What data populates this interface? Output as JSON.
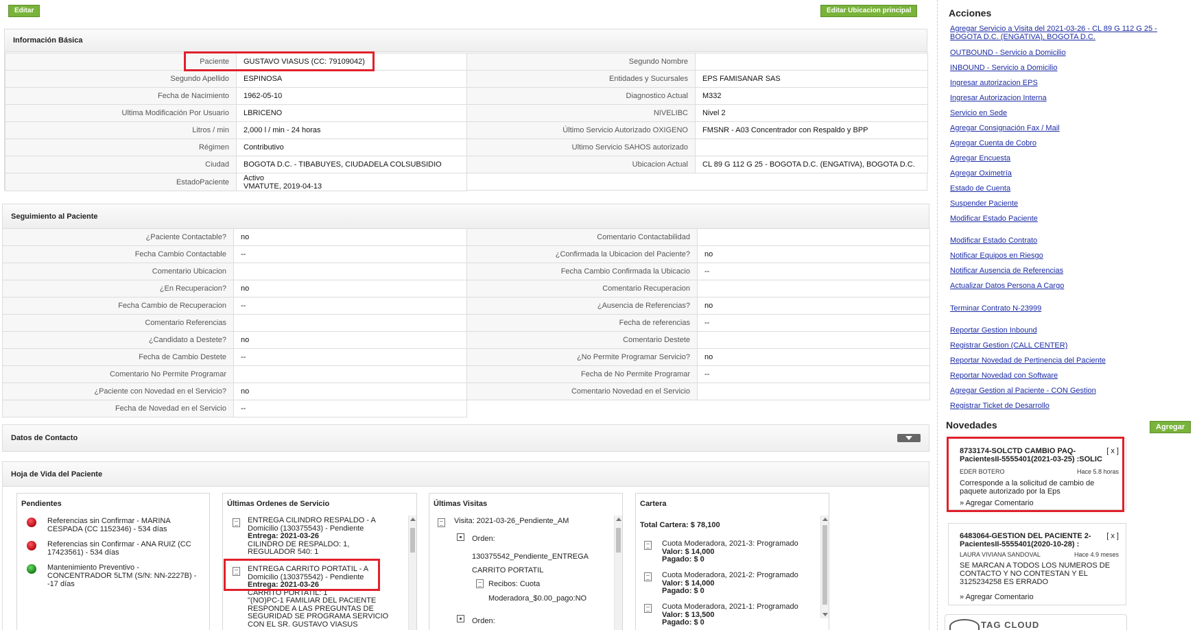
{
  "toolbar": {
    "edit_label": "Editar",
    "edit_location_label": "Editar Ubicacion principal"
  },
  "info_basica": {
    "title": "Información Básica",
    "left": [
      {
        "label": "Paciente",
        "value": "GUSTAVO VIASUS (CC: 79109042)"
      },
      {
        "label": "Segundo Apellido",
        "value": "ESPINOSA"
      },
      {
        "label": "Fecha de Nacimiento",
        "value": "1962-05-10"
      },
      {
        "label": "Ultima Modificación Por Usuario",
        "value": "LBRICENO"
      },
      {
        "label": "Litros / min",
        "value": "2,000 l / min - 24 horas"
      },
      {
        "label": "Régimen",
        "value": "Contributivo"
      },
      {
        "label": "Ciudad",
        "value": "BOGOTA D.C. - TIBABUYES, CIUDADELA COLSUBSIDIO"
      },
      {
        "label": "EstadoPaciente",
        "value1": "Activo",
        "value2": "VMATUTE, 2019-04-13"
      }
    ],
    "right": [
      {
        "label": "Segundo Nombre",
        "value": ""
      },
      {
        "label": "Entidades y Sucursales",
        "value": "EPS FAMISANAR SAS"
      },
      {
        "label": "Diagnostico Actual",
        "value": "M332"
      },
      {
        "label": "NIVELIBC",
        "value": "Nivel 2"
      },
      {
        "label": "Último Servicio Autorizado OXIGENO",
        "value": "FMSNR - A03 Concentrador con Respaldo y BPP"
      },
      {
        "label": "Ultimo Servicio SAHOS autorizado",
        "value": ""
      },
      {
        "label": "Ubicacion Actual",
        "value": "CL 89 G 112 G 25 - BOGOTA D.C. (ENGATIVA), BOGOTA D.C."
      }
    ]
  },
  "seguimiento": {
    "title": "Seguimiento al Paciente",
    "left": [
      {
        "label": "¿Paciente Contactable?",
        "value": "no"
      },
      {
        "label": "Fecha Cambio Contactable",
        "value": "--"
      },
      {
        "label": "Comentario Ubicacion",
        "value": ""
      },
      {
        "label": "¿En Recuperacion?",
        "value": "no"
      },
      {
        "label": "Fecha Cambio de Recuperacion",
        "value": "--"
      },
      {
        "label": "Comentario Referencias",
        "value": ""
      },
      {
        "label": "¿Candidato a Destete?",
        "value": "no"
      },
      {
        "label": "Fecha de Cambio Destete",
        "value": "--"
      },
      {
        "label": "Comentario No Permite Programar",
        "value": ""
      },
      {
        "label": "¿Paciente con Novedad en el Servicio?",
        "value": "no"
      },
      {
        "label": "Fecha de Novedad en el Servicio",
        "value": "--"
      }
    ],
    "right": [
      {
        "label": "Comentario Contactabilidad",
        "value": ""
      },
      {
        "label": "¿Confirmada la Ubicacion del Paciente?",
        "value": "no"
      },
      {
        "label": "Fecha Cambio Confirmada la Ubicacio",
        "value": "--"
      },
      {
        "label": "Comentario Recuperacion",
        "value": ""
      },
      {
        "label": "¿Ausencia de Referencias?",
        "value": "no"
      },
      {
        "label": "Fecha de referencias",
        "value": "--"
      },
      {
        "label": "Comentario Destete",
        "value": ""
      },
      {
        "label": "¿No Permite Programar Servicio?",
        "value": "no"
      },
      {
        "label": "Fecha de No Permite Programar",
        "value": "--"
      },
      {
        "label": "Comentario Novedad en el Servicio",
        "value": ""
      }
    ]
  },
  "contacto": {
    "title": "Datos de Contacto"
  },
  "hoja": {
    "title": "Hoja de Vida del Paciente",
    "pendientes": {
      "title": "Pendientes",
      "items": [
        {
          "text": "Referencias sin Confirmar - MARINA CESPADA (CC 1152346) - 534 días",
          "status": "red"
        },
        {
          "text": "Referencias sin Confirmar - ANA RUIZ (CC 17423561) - 534 días",
          "status": "red"
        },
        {
          "text": "Mantenimiento Preventivo - CONCENTRADOR 5LTM (S/N: NN-2227B) - -17 días",
          "status": "green"
        }
      ]
    },
    "ordenes": {
      "title": "Últimas Ordenes de Servicio",
      "o1_title": "ENTREGA CILINDRO RESPALDO - A Domicilio (130375543) - Pendiente",
      "o1_date": "Entrega: 2021-03-26",
      "o1_desc": "CILINDRO DE RESPALDO: 1, REGULADOR 540: 1",
      "o2_title": "ENTREGA CARRITO PORTATIL - A Domicilio (130375542) - Pendiente",
      "o2_date": "Entrega: 2021-03-26",
      "o2_desc1": "CARRITO PORTATIL: 1",
      "o2_desc2": "\"(NO)PC-1 FAMILIAR DEL PACIENTE RESPONDE A LAS PREGUNTAS DE SEGURIDAD SE PROGRAMA SERVICIO CON EL SR. GUSTAVO VIASUS"
    },
    "visitas": {
      "title": "Últimas Visitas",
      "visit": "Visita: 2021-03-26_Pendiente_AM",
      "orden_label": "Orden:",
      "orden_value1": "130375542_Pendiente_ENTREGA",
      "orden_value2": "CARRITO PORTATIL",
      "recibos1": "Recibos: Cuota",
      "recibos2": "Moderadora_$0.00_pago:NO",
      "orden2_label": "Orden:"
    },
    "cartera": {
      "title": "Cartera",
      "total": "Total Cartera: $ 78,100",
      "items": [
        {
          "title": "Cuota Moderadora, 2021-3: Programado",
          "valor": "Valor: $ 14,000",
          "pagado": "Pagado: $ 0"
        },
        {
          "title": "Cuota Moderadora, 2021-2: Programado",
          "valor": "Valor: $ 14,000",
          "pagado": "Pagado: $ 0"
        },
        {
          "title": "Cuota Moderadora, 2021-1: Programado",
          "valor": "Valor: $ 13,500",
          "pagado": "Pagado: $ 0"
        }
      ]
    }
  },
  "acciones": {
    "title": "Acciones",
    "items": [
      "Agregar Servicio a Visita del 2021-03-26 - CL 89 G 112 G 25 -",
      "BOGOTA D.C. (ENGATIVA), BOGOTA D.C.",
      "OUTBOUND - Servicio a Domicilio",
      "INBOUND - Servicio a Domicilio",
      "Ingresar autorizacion EPS",
      "Ingresar Autorizacion Interna",
      "Servicio en Sede",
      "Agregar Consignación Fax / Mail",
      "Agregar Cuenta de Cobro",
      "Agregar Encuesta",
      "Agregar Oximetría",
      "Estado de Cuenta",
      "Suspender Paciente",
      "Modificar Estado Paciente",
      "Modificar Estado Contrato",
      "Notificar Equipos en Riesgo",
      "Notificar Ausencia de Referencias",
      "Actualizar Datos Persona A Cargo",
      "Terminar Contrato N-23999",
      "Reportar Gestion Inbound",
      "Registrar Gestion (CALL CENTER)",
      "Reportar Novedad de Pertinencia del Paciente",
      "Reportar Novedad con Software",
      "Agregar Gestion al Paciente - CON Gestion",
      "Registrar Ticket de Desarrollo"
    ]
  },
  "novedades": {
    "title": "Novedades",
    "add_label": "Agregar",
    "items": [
      {
        "title1": "8733174-SOLCTD CAMBIO PAQ-",
        "title2": "PacientesII-5555401(2021-03-25) :SOLIC",
        "close": "[ x ]",
        "author": "EDER BOTERO",
        "ago": "Hace 5.8 horas",
        "desc": "Corresponde a la solicitud de cambio de paquete autorizado por la Eps",
        "comment": "» Agregar Comentario"
      },
      {
        "title1": "6483064-GESTION DEL PACIENTE 2-",
        "title2": "PacientesII-5555401(2020-10-28) :",
        "close": "[ x ]",
        "author": "LAURA VIVIANA SANDOVAL",
        "ago": "Hace 4.9 meses",
        "desc": "SE MARCAN A TODOS LOS NUMEROS DE CONTACTO Y NO CONTESTAN Y EL 3125234258 ES ERRADO",
        "comment": "» Agregar Comentario"
      }
    ]
  },
  "tagcloud": {
    "title": "TAG CLOUD"
  }
}
